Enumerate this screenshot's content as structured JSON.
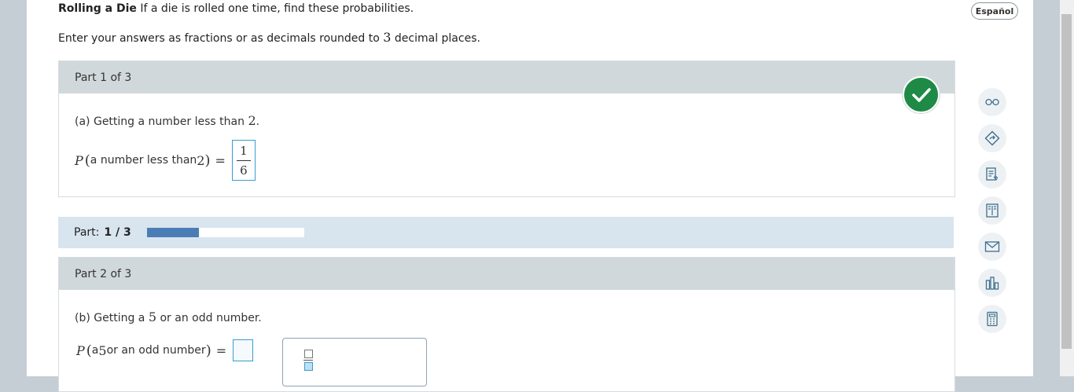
{
  "header": {
    "title_bold": "Rolling a Die",
    "title_rest": " If a die is rolled one time, find these probabilities.",
    "instruction_pre": "Enter your answers as fractions or as decimals rounded to ",
    "instruction_num": "3",
    "instruction_post": " decimal places.",
    "language_button": "Español"
  },
  "part1": {
    "heading": "Part 1 of 3",
    "question_label": "(a)",
    "question_text": " Getting a number less than ",
    "question_num": "2",
    "question_end": ".",
    "eq_P": "P",
    "eq_text": "a number less than ",
    "eq_num": "2",
    "eq_equals": "=",
    "answer_numerator": "1",
    "answer_denominator": "6",
    "status": "correct"
  },
  "progress": {
    "label": "Part:",
    "value": "1 / 3",
    "fraction_complete": 0.333
  },
  "part2": {
    "heading": "Part 2 of 3",
    "question_label": "(b)",
    "question_text": " Getting a ",
    "question_num": "5",
    "question_end": " or an odd number.",
    "eq_P": "P",
    "eq_text_a": "a ",
    "eq_num": "5",
    "eq_text_b": " or an odd number",
    "eq_equals": "=",
    "answer_value": ""
  },
  "sidebar_tools": [
    {
      "icon": "glasses-icon"
    },
    {
      "icon": "hint-icon"
    },
    {
      "icon": "worksheet-icon"
    },
    {
      "icon": "ebook-icon"
    },
    {
      "icon": "message-icon"
    },
    {
      "icon": "chart-icon"
    },
    {
      "icon": "calculator-icon"
    }
  ],
  "colors": {
    "check_green": "#1e8a46",
    "progress_blue": "#4a7db5",
    "input_border": "#3a9bd0",
    "part_header_bg": "#d1d8dc"
  }
}
